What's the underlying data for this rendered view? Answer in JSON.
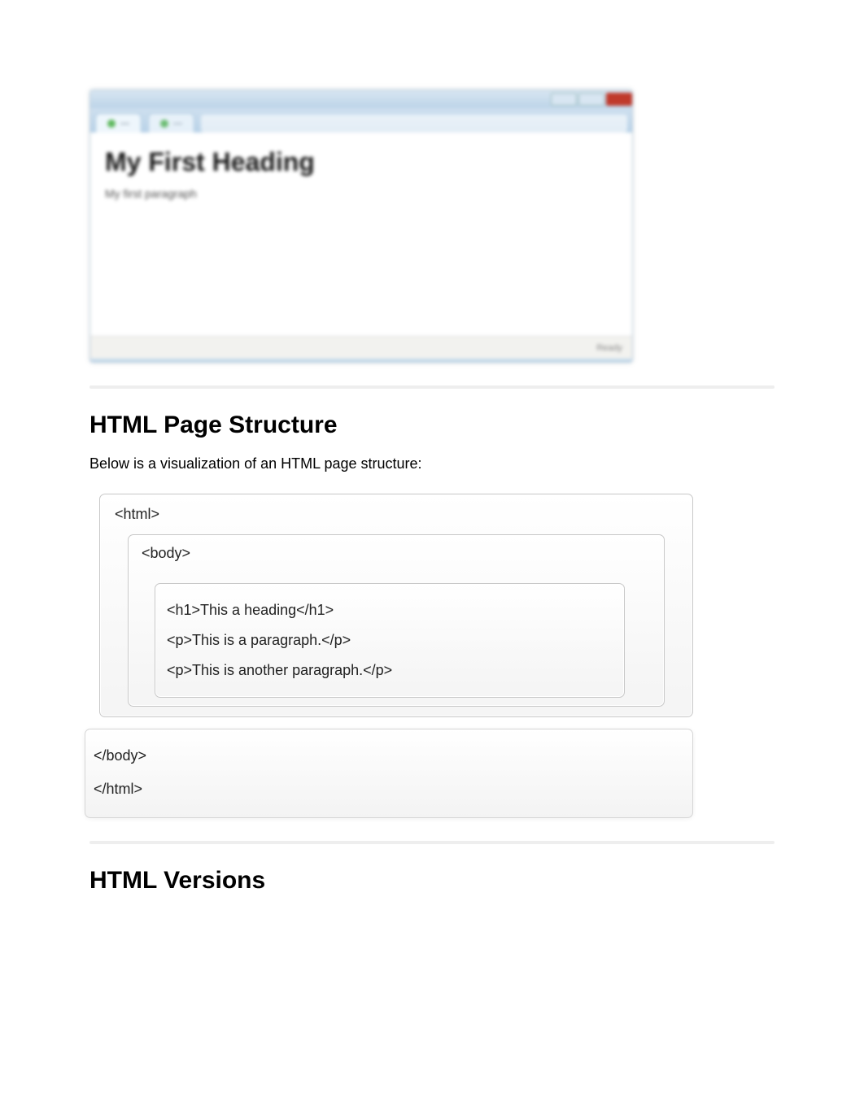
{
  "screenshot": {
    "heading": "My First Heading",
    "paragraph": "My first paragraph",
    "status": "Ready"
  },
  "section1": {
    "title": "HTML Page Structure",
    "intro": "Below is a visualization of an HTML page structure:"
  },
  "structure": {
    "html_open": "<html>",
    "body_open": "<body>",
    "h1_line": "<h1>This a heading</h1>",
    "p1_line": "<p>This is a paragraph.</p>",
    "p2_line": "<p>This is another paragraph.</p>",
    "body_close": "</body>",
    "html_close": "</html>"
  },
  "section2": {
    "title": "HTML Versions"
  }
}
